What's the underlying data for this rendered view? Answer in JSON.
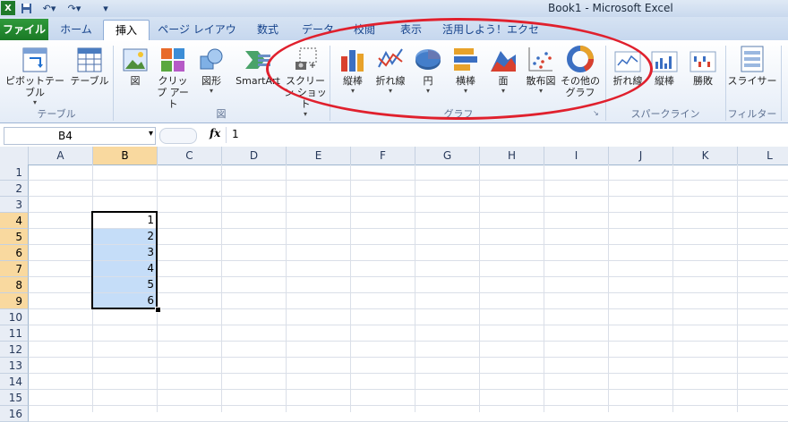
{
  "window": {
    "title": "Book1 - Microsoft Excel"
  },
  "tabs": [
    {
      "label": "ファイル"
    },
    {
      "label": "ホーム"
    },
    {
      "label": "挿入"
    },
    {
      "label": "ページ レイアウト"
    },
    {
      "label": "数式"
    },
    {
      "label": "データ"
    },
    {
      "label": "校閲"
    },
    {
      "label": "表示"
    },
    {
      "label": "活用しよう！エクセル"
    }
  ],
  "ribbon": {
    "buttons": [
      {
        "label": "ピボットテーブル",
        "icon": "pivot-table-icon"
      },
      {
        "label": "テーブル",
        "icon": "table-icon"
      },
      {
        "label": "図",
        "icon": "picture-icon"
      },
      {
        "label": "クリップ アート",
        "icon": "clip-art-icon"
      },
      {
        "label": "図形",
        "icon": "shapes-icon"
      },
      {
        "label": "SmartArt",
        "icon": "smartart-icon"
      },
      {
        "label": "スクリーン ショット",
        "icon": "screenshot-icon"
      },
      {
        "label": "縦棒",
        "icon": "column-chart-icon"
      },
      {
        "label": "折れ線",
        "icon": "line-chart-icon"
      },
      {
        "label": "円",
        "icon": "pie-chart-icon"
      },
      {
        "label": "横棒",
        "icon": "bar-chart-icon"
      },
      {
        "label": "面",
        "icon": "area-chart-icon"
      },
      {
        "label": "散布図",
        "icon": "scatter-chart-icon"
      },
      {
        "label": "その他の グラフ",
        "icon": "other-charts-icon"
      },
      {
        "label": "折れ線",
        "icon": "sparkline-line-icon"
      },
      {
        "label": "縦棒",
        "icon": "sparkline-column-icon"
      },
      {
        "label": "勝敗",
        "icon": "sparkline-winloss-icon"
      },
      {
        "label": "スライサー",
        "icon": "slicer-icon"
      }
    ],
    "groups": [
      {
        "label": "テーブル"
      },
      {
        "label": "図"
      },
      {
        "label": "グラフ"
      },
      {
        "label": "スパークライン"
      },
      {
        "label": "フィルター"
      }
    ],
    "annotation_color": "#e0202d"
  },
  "formula_bar": {
    "name_box": "B4",
    "fx": "fx",
    "formula": "1"
  },
  "sheet": {
    "columns": [
      "A",
      "B",
      "C",
      "D",
      "E",
      "F",
      "G",
      "H",
      "I",
      "J",
      "K",
      "L"
    ],
    "rows": [
      "1",
      "2",
      "3",
      "4",
      "5",
      "6",
      "7",
      "8",
      "9",
      "10",
      "11",
      "12",
      "13",
      "14",
      "15",
      "16"
    ],
    "selected_column": "B",
    "selected_rows": [
      "4",
      "5",
      "6",
      "7",
      "8",
      "9"
    ],
    "active_cell": "B4",
    "selection_color": "#c5ddf8",
    "cells": [
      {
        "ref": "B4",
        "value": "1"
      },
      {
        "ref": "B5",
        "value": "2"
      },
      {
        "ref": "B6",
        "value": "3"
      },
      {
        "ref": "B7",
        "value": "4"
      },
      {
        "ref": "B8",
        "value": "5"
      },
      {
        "ref": "B9",
        "value": "6"
      }
    ]
  }
}
